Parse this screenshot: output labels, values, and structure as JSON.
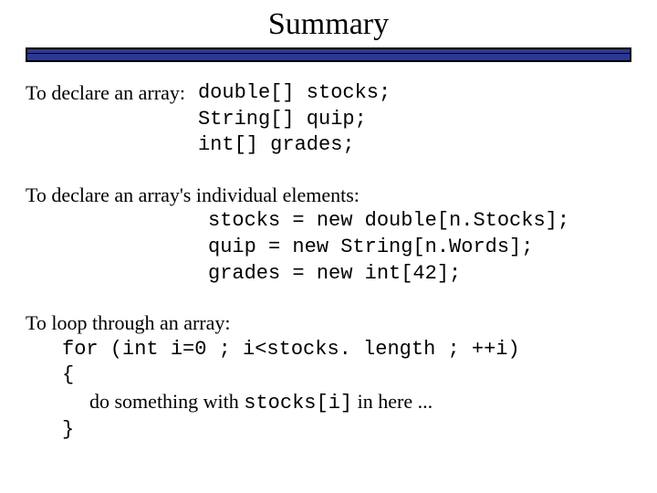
{
  "title": "Summary",
  "section1": {
    "lead": "To declare an array:",
    "code1": "double[] stocks;",
    "code2": "String[] quip;",
    "code3": "int[]    grades;"
  },
  "section2": {
    "lead": "To declare an array's individual elements:",
    "code1": "stocks = new double[n.Stocks];",
    "code2": "quip = new String[n.Words];",
    "code3": "grades = new int[42];"
  },
  "section3": {
    "lead": "To loop through an array:",
    "for_line": "for (int i=0 ; i<stocks. length ; ++i)",
    "open_brace": "{",
    "body_pre": "do something with ",
    "body_code": "stocks[i]",
    "body_post": " in here ...",
    "close_brace": "}"
  }
}
